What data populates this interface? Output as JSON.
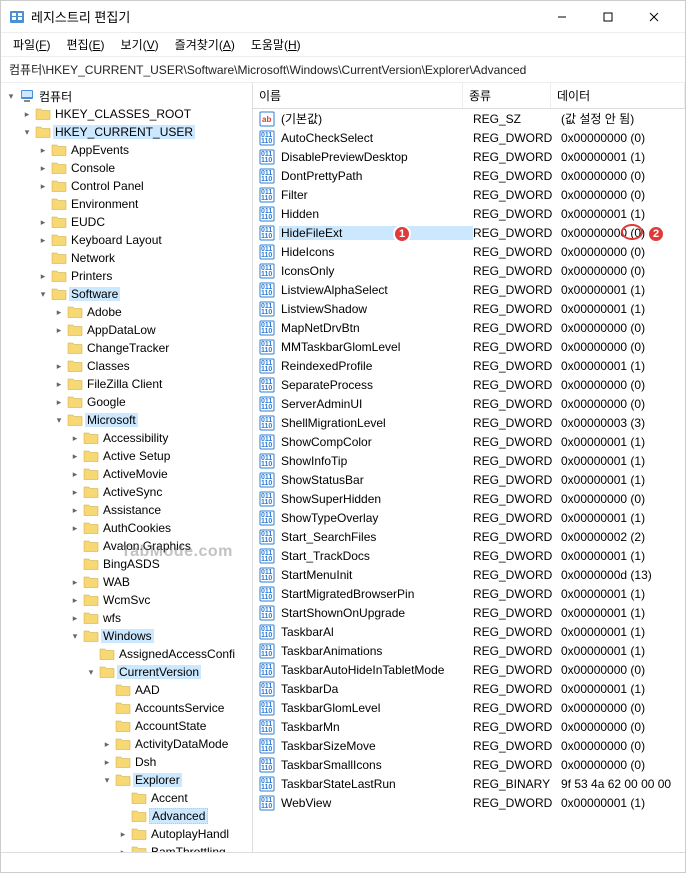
{
  "window": {
    "title": "레지스트리 편집기"
  },
  "menus": {
    "file": "파일",
    "file_u": "F",
    "edit": "편집",
    "edit_u": "E",
    "view": "보기",
    "view_u": "V",
    "fav": "즐겨찾기",
    "fav_u": "A",
    "help": "도움말",
    "help_u": "H"
  },
  "path": "컴퓨터\\HKEY_CURRENT_USER\\Software\\Microsoft\\Windows\\CurrentVersion\\Explorer\\Advanced",
  "tree": {
    "root": "컴퓨터",
    "hkcr": "HKEY_CLASSES_ROOT",
    "hkcu": "HKEY_CURRENT_USER",
    "appevents": "AppEvents",
    "console": "Console",
    "controlpanel": "Control Panel",
    "environment": "Environment",
    "eudc": "EUDC",
    "keyboard": "Keyboard Layout",
    "network": "Network",
    "printers": "Printers",
    "software": "Software",
    "adobe": "Adobe",
    "appdatalow": "AppDataLow",
    "changetracker": "ChangeTracker",
    "classes": "Classes",
    "filezilla": "FileZilla Client",
    "google": "Google",
    "microsoft": "Microsoft",
    "accessibility": "Accessibility",
    "activesetup": "Active Setup",
    "activemovie": "ActiveMovie",
    "activesync": "ActiveSync",
    "assistance": "Assistance",
    "authcookies": "AuthCookies",
    "avalon": "Avalon.Graphics",
    "bingasds": "BingASDS",
    "wab": "WAB",
    "wcmsvc": "WcmSvc",
    "wfs": "wfs",
    "windows": "Windows",
    "assignedaccess": "AssignedAccessConfi",
    "currentversion": "CurrentVersion",
    "aad": "AAD",
    "accountsservice": "AccountsService",
    "accountstate": "AccountState",
    "activitydatamode": "ActivityDataMode",
    "dsh": "Dsh",
    "explorer": "Explorer",
    "accent": "Accent",
    "advanced": "Advanced",
    "autoplayhandl": "AutoplayHandl",
    "bamthrottling": "BamThrottling"
  },
  "list": {
    "headers": {
      "name": "이름",
      "type": "종류",
      "data": "데이터"
    },
    "rows": [
      {
        "icon": "sz",
        "name": "(기본값)",
        "type": "REG_SZ",
        "data": "(값 설정 안 됨)"
      },
      {
        "icon": "dw",
        "name": "AutoCheckSelect",
        "type": "REG_DWORD",
        "data": "0x00000000 (0)"
      },
      {
        "icon": "dw",
        "name": "DisablePreviewDesktop",
        "type": "REG_DWORD",
        "data": "0x00000001 (1)"
      },
      {
        "icon": "dw",
        "name": "DontPrettyPath",
        "type": "REG_DWORD",
        "data": "0x00000000 (0)"
      },
      {
        "icon": "dw",
        "name": "Filter",
        "type": "REG_DWORD",
        "data": "0x00000000 (0)"
      },
      {
        "icon": "dw",
        "name": "Hidden",
        "type": "REG_DWORD",
        "data": "0x00000001 (1)"
      },
      {
        "icon": "dw",
        "name": "HideFileExt",
        "type": "REG_DWORD",
        "data": "0x00000000 (0)",
        "selected": true
      },
      {
        "icon": "dw",
        "name": "HideIcons",
        "type": "REG_DWORD",
        "data": "0x00000000 (0)"
      },
      {
        "icon": "dw",
        "name": "IconsOnly",
        "type": "REG_DWORD",
        "data": "0x00000000 (0)"
      },
      {
        "icon": "dw",
        "name": "ListviewAlphaSelect",
        "type": "REG_DWORD",
        "data": "0x00000001 (1)"
      },
      {
        "icon": "dw",
        "name": "ListviewShadow",
        "type": "REG_DWORD",
        "data": "0x00000001 (1)"
      },
      {
        "icon": "dw",
        "name": "MapNetDrvBtn",
        "type": "REG_DWORD",
        "data": "0x00000000 (0)"
      },
      {
        "icon": "dw",
        "name": "MMTaskbarGlomLevel",
        "type": "REG_DWORD",
        "data": "0x00000000 (0)"
      },
      {
        "icon": "dw",
        "name": "ReindexedProfile",
        "type": "REG_DWORD",
        "data": "0x00000001 (1)"
      },
      {
        "icon": "dw",
        "name": "SeparateProcess",
        "type": "REG_DWORD",
        "data": "0x00000000 (0)"
      },
      {
        "icon": "dw",
        "name": "ServerAdminUI",
        "type": "REG_DWORD",
        "data": "0x00000000 (0)"
      },
      {
        "icon": "dw",
        "name": "ShellMigrationLevel",
        "type": "REG_DWORD",
        "data": "0x00000003 (3)"
      },
      {
        "icon": "dw",
        "name": "ShowCompColor",
        "type": "REG_DWORD",
        "data": "0x00000001 (1)"
      },
      {
        "icon": "dw",
        "name": "ShowInfoTip",
        "type": "REG_DWORD",
        "data": "0x00000001 (1)"
      },
      {
        "icon": "dw",
        "name": "ShowStatusBar",
        "type": "REG_DWORD",
        "data": "0x00000001 (1)"
      },
      {
        "icon": "dw",
        "name": "ShowSuperHidden",
        "type": "REG_DWORD",
        "data": "0x00000000 (0)"
      },
      {
        "icon": "dw",
        "name": "ShowTypeOverlay",
        "type": "REG_DWORD",
        "data": "0x00000001 (1)"
      },
      {
        "icon": "dw",
        "name": "Start_SearchFiles",
        "type": "REG_DWORD",
        "data": "0x00000002 (2)"
      },
      {
        "icon": "dw",
        "name": "Start_TrackDocs",
        "type": "REG_DWORD",
        "data": "0x00000001 (1)"
      },
      {
        "icon": "dw",
        "name": "StartMenuInit",
        "type": "REG_DWORD",
        "data": "0x0000000d (13)"
      },
      {
        "icon": "dw",
        "name": "StartMigratedBrowserPin",
        "type": "REG_DWORD",
        "data": "0x00000001 (1)"
      },
      {
        "icon": "dw",
        "name": "StartShownOnUpgrade",
        "type": "REG_DWORD",
        "data": "0x00000001 (1)"
      },
      {
        "icon": "dw",
        "name": "TaskbarAl",
        "type": "REG_DWORD",
        "data": "0x00000001 (1)"
      },
      {
        "icon": "dw",
        "name": "TaskbarAnimations",
        "type": "REG_DWORD",
        "data": "0x00000001 (1)"
      },
      {
        "icon": "dw",
        "name": "TaskbarAutoHideInTabletMode",
        "type": "REG_DWORD",
        "data": "0x00000000 (0)"
      },
      {
        "icon": "dw",
        "name": "TaskbarDa",
        "type": "REG_DWORD",
        "data": "0x00000001 (1)"
      },
      {
        "icon": "dw",
        "name": "TaskbarGlomLevel",
        "type": "REG_DWORD",
        "data": "0x00000000 (0)"
      },
      {
        "icon": "dw",
        "name": "TaskbarMn",
        "type": "REG_DWORD",
        "data": "0x00000000 (0)"
      },
      {
        "icon": "dw",
        "name": "TaskbarSizeMove",
        "type": "REG_DWORD",
        "data": "0x00000000 (0)"
      },
      {
        "icon": "dw",
        "name": "TaskbarSmallIcons",
        "type": "REG_DWORD",
        "data": "0x00000000 (0)"
      },
      {
        "icon": "bin",
        "name": "TaskbarStateLastRun",
        "type": "REG_BINARY",
        "data": "9f 53 4a 62 00 00 00"
      },
      {
        "icon": "dw",
        "name": "WebView",
        "type": "REG_DWORD",
        "data": "0x00000001 (1)"
      }
    ]
  },
  "badges": {
    "b1": "1",
    "b2": "2"
  },
  "watermark": "TabMode.com"
}
